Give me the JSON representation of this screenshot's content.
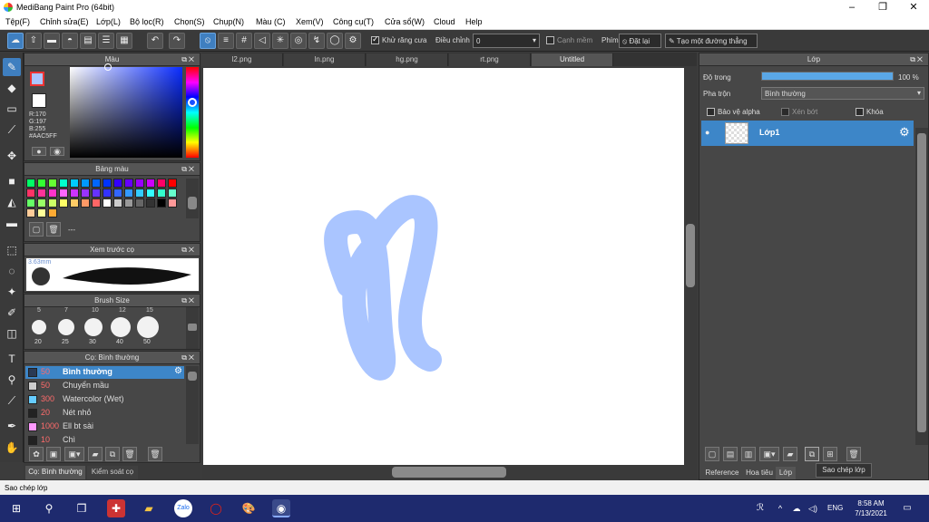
{
  "window": {
    "title": "MediBang Paint Pro (64bit)"
  },
  "menu": [
    "Tệp(F)",
    "Chỉnh sửa(E)",
    "Lớp(L)",
    "Bộ lọc(R)",
    "Chọn(S)",
    "Chụp(N)",
    "Màu (C)",
    "Xem(V)",
    "Công cụ(T)",
    "Cửa sổ(W)",
    "Cloud",
    "Help"
  ],
  "toolbar": {
    "antialias_label": "Khử răng cưa",
    "correction_label": "Điều chỉnh",
    "correction_value": "0",
    "edge_label": "Cạnh mềm",
    "key_label": "Phím",
    "reset_label": "Đặt lại",
    "straight_line_label": "Tạo một đường thẳng"
  },
  "color_panel": {
    "title": "Màu",
    "r": "R:170",
    "g": "G:197",
    "b": "B:255",
    "hex": "#AAC5FF",
    "primary_color": "#AAC5FF"
  },
  "palette_panel": {
    "title": "Bảng màu",
    "footer_text": "---",
    "colors": [
      "#00ff66",
      "#33ff33",
      "#66ff33",
      "#00ffcc",
      "#00ccff",
      "#0099ff",
      "#0066ff",
      "#0033ff",
      "#3300ff",
      "#6600ff",
      "#9900ff",
      "#cc00ff",
      "#ff0066",
      "#ff0000",
      "#ff3366",
      "#ff3399",
      "#ff33cc",
      "#ff66ff",
      "#cc33ff",
      "#9933ff",
      "#6633ff",
      "#3333ff",
      "#3366ff",
      "#3399ff",
      "#33ccff",
      "#33ffff",
      "#33ffcc",
      "#66ffcc",
      "#66ff66",
      "#99ff66",
      "#ccff66",
      "#ffff66",
      "#ffcc66",
      "#ff9966",
      "#ff6666",
      "#ffffff",
      "#cccccc",
      "#999999",
      "#666666",
      "#333333",
      "#000000",
      "#ff9999",
      "#ffcc99",
      "#ffff99",
      "#ffaa33"
    ]
  },
  "preview_panel": {
    "title": "Xem trước cọ",
    "size_label": "3.63mm"
  },
  "brush_size_panel": {
    "title": "Brush Size",
    "top_sizes": [
      "5",
      "7",
      "10",
      "12",
      "15"
    ],
    "sizes": [
      "20",
      "25",
      "30",
      "40",
      "50"
    ]
  },
  "brush_panel": {
    "title": "Cọ: Bình thường",
    "items": [
      {
        "size": "50",
        "name": "Bình thường",
        "color": "#2a3a55",
        "selected": true
      },
      {
        "size": "50",
        "name": "Chuyển mầu",
        "color": "#cccccc"
      },
      {
        "size": "300",
        "name": "Watercolor (Wet)",
        "color": "#66ccff"
      },
      {
        "size": "20",
        "name": "Nét nhỏ",
        "color": "#222222"
      },
      {
        "size": "1000",
        "name": "Ell bt sài",
        "color": "#ff99ff"
      },
      {
        "size": "10",
        "name": "Chì",
        "color": "#222222"
      }
    ]
  },
  "bottom_left_tabs": [
    "Cọ: Bình thường",
    "Kiểm soát cọ"
  ],
  "canvas_tabs": [
    "l2.png",
    "ln.png",
    "hg.png",
    "rt.png",
    "Untitled"
  ],
  "layer_panel": {
    "title": "Lớp",
    "opacity_label": "Độ trong",
    "opacity_value": "100 %",
    "opacity_fraction": 1.0,
    "blend_label": "Pha trộn",
    "blend_value": "Bình thường",
    "protect_alpha_label": "Bảo vệ alpha",
    "clipping_label": "Xén bớt",
    "lock_label": "Khóa",
    "layers": [
      {
        "name": "Lớp1"
      }
    ],
    "tooltip": "Sao chép lớp",
    "bottom_tabs": [
      "Reference",
      "Hoa tiêu",
      "Lớp"
    ]
  },
  "status_bar": {
    "text": "Sao chép lớp"
  },
  "taskbar": {
    "language": "ENG",
    "time": "8:58 AM",
    "date": "7/13/2021"
  },
  "stroke_color": "#AAC5FF",
  "accent_color": "#3F7FC0"
}
